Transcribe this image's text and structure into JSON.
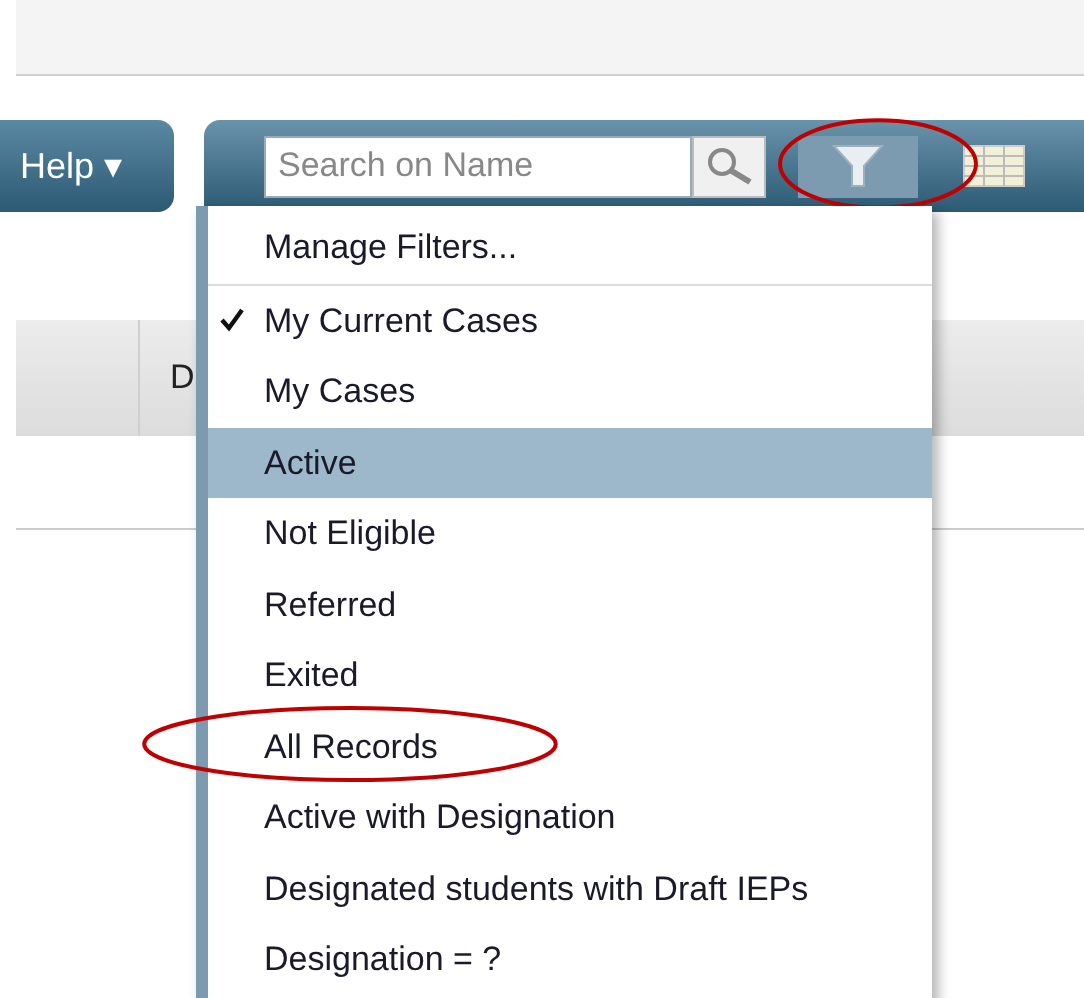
{
  "toolbar": {
    "help_button": {
      "label": "Help ▾"
    },
    "search": {
      "placeholder": "Search on Name"
    },
    "filter_button": {
      "selected": true,
      "circled": true
    }
  },
  "table": {
    "columns": [
      {
        "label": "D"
      }
    ]
  },
  "filter_menu": {
    "items": [
      {
        "kind": "action",
        "label": "Manage Filters...",
        "checked": false,
        "selected": false,
        "circled": false
      },
      {
        "kind": "filter",
        "label": "My Current Cases",
        "checked": true,
        "selected": false,
        "circled": false
      },
      {
        "kind": "filter",
        "label": "My Cases",
        "checked": false,
        "selected": false,
        "circled": false
      },
      {
        "kind": "filter",
        "label": "Active",
        "checked": false,
        "selected": true,
        "circled": false
      },
      {
        "kind": "filter",
        "label": "Not Eligible",
        "checked": false,
        "selected": false,
        "circled": false
      },
      {
        "kind": "filter",
        "label": "Referred",
        "checked": false,
        "selected": false,
        "circled": false
      },
      {
        "kind": "filter",
        "label": "Exited",
        "checked": false,
        "selected": false,
        "circled": false
      },
      {
        "kind": "filter",
        "label": "All Records",
        "checked": false,
        "selected": false,
        "circled": true
      },
      {
        "kind": "filter",
        "label": "Active with Designation",
        "checked": false,
        "selected": false,
        "circled": false
      },
      {
        "kind": "filter",
        "label": "Designated students with Draft IEPs",
        "checked": false,
        "selected": false,
        "circled": false
      },
      {
        "kind": "filter",
        "label": "Designation = ?",
        "checked": false,
        "selected": false,
        "circled": false
      }
    ]
  }
}
